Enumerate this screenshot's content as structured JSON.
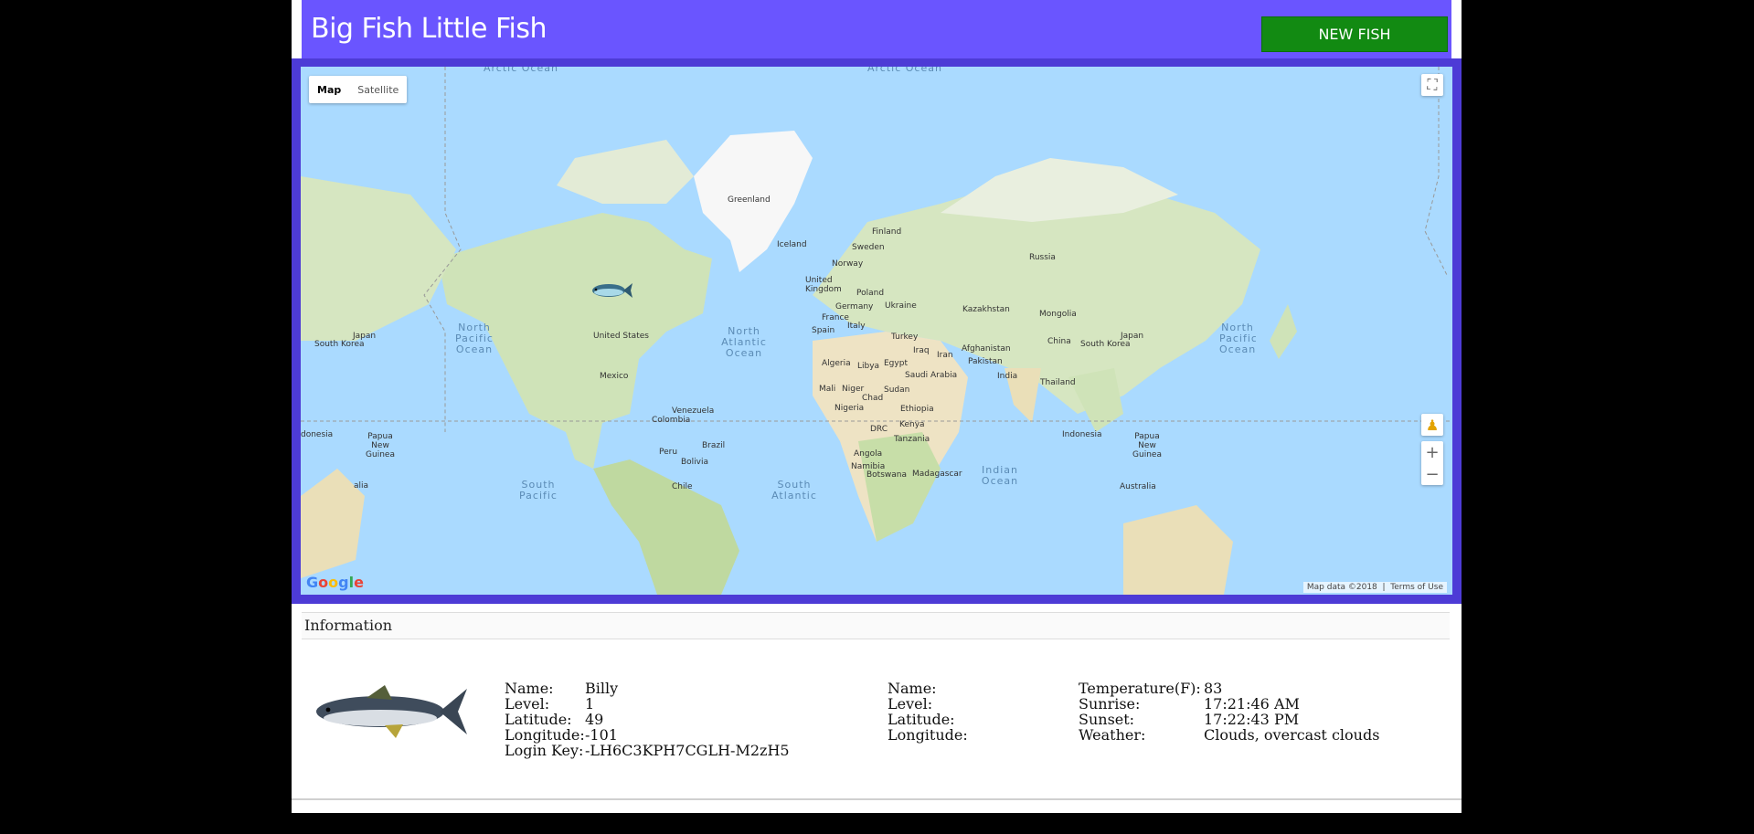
{
  "header": {
    "title": "Big Fish Little Fish",
    "new_fish_label": "NEW FISH"
  },
  "map": {
    "type_controls": [
      "Map",
      "Satellite"
    ],
    "oceans": {
      "arctic1": "Arctic Ocean",
      "arctic2": "Arctic Ocean",
      "north_pacific": "North Pacific Ocean",
      "north_atlantic": "North Atlantic Ocean",
      "south_pacific": "South Pacific",
      "south_atlantic": "South Atlantic",
      "indian": "Indian Ocean",
      "north_pacific_right": "North Pacific Ocean"
    },
    "places": {
      "greenland": "Greenland",
      "iceland": "Iceland",
      "finland": "Finland",
      "sweden": "Sweden",
      "norway": "Norway",
      "uk": "United Kingdom",
      "poland": "Poland",
      "germany": "Germany",
      "ukraine": "Ukraine",
      "france": "France",
      "italy": "Italy",
      "spain": "Spain",
      "turkey": "Turkey",
      "iraq": "Iraq",
      "iran": "Iran",
      "afghanistan": "Afghanistan",
      "pakistan": "Pakistan",
      "india": "India",
      "thailand": "Thailand",
      "kazakhstan": "Kazakhstan",
      "mongolia": "Mongolia",
      "china": "China",
      "russia": "Russia",
      "japan_l": "Japan",
      "japan_r": "Japan",
      "south_korea_l": "South Korea",
      "south_korea_r": "South Korea",
      "united_states": "United States",
      "mexico": "Mexico",
      "venezuela": "Venezuela",
      "colombia": "Colombia",
      "peru": "Peru",
      "brazil": "Brazil",
      "bolivia": "Bolivia",
      "chile": "Chile",
      "algeria": "Algeria",
      "libya": "Libya",
      "egypt": "Egypt",
      "saudi_arabia": "Saudi Arabia",
      "mali": "Mali",
      "niger": "Niger",
      "chad": "Chad",
      "sudan": "Sudan",
      "nigeria": "Nigeria",
      "ethiopia": "Ethiopia",
      "drc": "DRC",
      "kenya": "Kenya",
      "tanzania": "Tanzania",
      "angola": "Angola",
      "namibia": "Namibia",
      "botswana": "Botswana",
      "madagascar": "Madagascar",
      "indonesia_l": "donesia",
      "indonesia_r": "Indonesia",
      "png_l": "Papua New Guinea",
      "png_r": "Papua New Guinea",
      "australia_l": "alia",
      "australia_r": "Australia"
    },
    "attribution": "Map data ©2018",
    "terms": "Terms of Use",
    "logo": "Google"
  },
  "info": {
    "heading": "Information",
    "fish": {
      "name_label": "Name:",
      "name": "Billy",
      "level_label": "Level:",
      "level": "1",
      "lat_label": "Latitude:",
      "lat": "49",
      "lon_label": "Longitude:",
      "lon": "-101",
      "key_label": "Login Key:",
      "key": "-LH6C3KPH7CGLH-M2zH5"
    },
    "other": {
      "name_label": "Name:",
      "level_label": "Level:",
      "lat_label": "Latitude:",
      "lon_label": "Longitude:"
    },
    "weather": {
      "temp_label": "Temperature(F):",
      "temp": "83",
      "sunrise_label": "Sunrise:",
      "sunrise": "17:21:46 AM",
      "sunset_label": "Sunset:",
      "sunset": "17:22:43 PM",
      "weather_label": "Weather:",
      "weather": "Clouds, overcast clouds"
    }
  }
}
